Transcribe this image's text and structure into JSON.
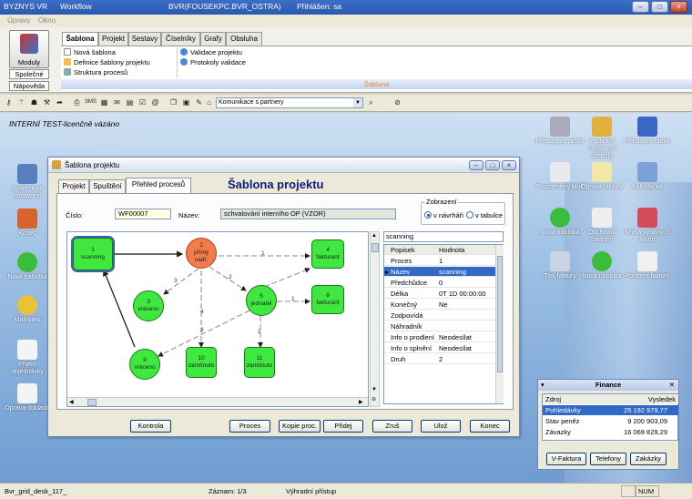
{
  "window": {
    "app": "BYZNYS VR",
    "module": "Workflow",
    "server": "BVR(FOUSEKPC.BVR_OSTRA)",
    "user": "Přihlášen: sa"
  },
  "menu": [
    "Úpravy",
    "Okno"
  ],
  "left_buttons": {
    "modules": "Moduly",
    "common": "Společné",
    "help": "Nápověda"
  },
  "ribbon": {
    "tabs": [
      "Šablona",
      "Projekt",
      "Sestavy",
      "Číselníky",
      "Grafy",
      "Obsluha"
    ],
    "items_left": [
      "Nová šablona",
      "Definice šablony projektu",
      "Struktura procesů"
    ],
    "items_right": [
      "Validace projektu",
      "Protokoly validace"
    ],
    "strip": "Šablona"
  },
  "toolbar": {
    "combo_value": "Komunikace s partnery"
  },
  "license_note": "INTERNÍ TEST-licenčně vázáno",
  "desktop_left": [
    "Systémové nastavení",
    "Konec",
    "Nová nabídka",
    "Malování",
    "Přijem objednávky",
    "Oprava dokladu"
  ],
  "desktop_right": [
    [
      "Přístupová práva",
      "Implicitní nastavení vzhledu",
      "Příkazový řádek"
    ],
    [
      "Pozměněný blok",
      "Oprava faktury",
      "Kalkulačka"
    ],
    [
      "Nová nabídka",
      "Obchodní partneři",
      "Kniha vydaných faktur"
    ],
    [
      "Tisk faktury",
      "Nová nabídka",
      "Pořízení faktury"
    ]
  ],
  "dialog": {
    "title": "Šablona projektu",
    "heading": "Šablona projektu",
    "tabs": [
      "Projekt",
      "Spuštění",
      "Přehled procesů"
    ],
    "cislo_label": "Číslo:",
    "cislo_value": "WF00007",
    "nazev_label": "Název:",
    "nazev_value": "schvalování interního OP (VZOR)",
    "zobrazeni": {
      "legend": "Zobrazení",
      "opt1": "v návrháři",
      "opt2": "v tabulce"
    },
    "nodes": [
      {
        "num": "1",
        "label": "scanning"
      },
      {
        "num": "2",
        "label": "přímý nadř."
      },
      {
        "num": "3",
        "label": "vráceno"
      },
      {
        "num": "4",
        "label": "fakturant"
      },
      {
        "num": "5",
        "label": "jednatel"
      },
      {
        "num": "8",
        "label": "fakturant"
      },
      {
        "num": "9",
        "label": "vráceno"
      },
      {
        "num": "10",
        "label": "zamítnuto"
      },
      {
        "num": "11",
        "label": "zamítnuto"
      }
    ],
    "edge_labels": [
      "1",
      "2",
      "3",
      "4",
      "1",
      "2",
      "3"
    ],
    "props": {
      "search": "scanning",
      "headers": [
        "Popisek",
        "Hodnota"
      ],
      "rows": [
        [
          "Proces",
          "1"
        ],
        [
          "Název",
          "scanning"
        ],
        [
          "Předchůdce",
          "0"
        ],
        [
          "Délka",
          "0T 1D 00:00:00"
        ],
        [
          "Konečný",
          "Ne"
        ],
        [
          "Zodpovídá",
          ""
        ],
        [
          "Náhradník",
          ""
        ],
        [
          "Info o prodlení",
          "Neodesílat"
        ],
        [
          "Info o splnění",
          "Neodesílat"
        ],
        [
          "Druh",
          "2"
        ]
      ]
    },
    "buttons": {
      "kontrola": "Kontrola",
      "proces": "Proces",
      "kopie": "Kopie proc.",
      "pridej": "Přidej",
      "zrus": "Zruš",
      "uloz": "Ulož",
      "konec": "Konec"
    }
  },
  "finance": {
    "title": "Finance",
    "headers": [
      "Zdroj",
      "Vysledek"
    ],
    "rows": [
      [
        "Pohledávky",
        "25 192 979,77"
      ],
      [
        "Stav peněz",
        "9 200 903,09"
      ],
      [
        "Závazky",
        "16 069 829,29"
      ]
    ],
    "buttons": [
      "V-Faktura",
      "Telefony",
      "Zakázky"
    ]
  },
  "status": {
    "left": "Bvr_grid_desk_117_",
    "record": "Záznam: 1/3",
    "access": "Výhradní přístup",
    "num": "NUM"
  }
}
